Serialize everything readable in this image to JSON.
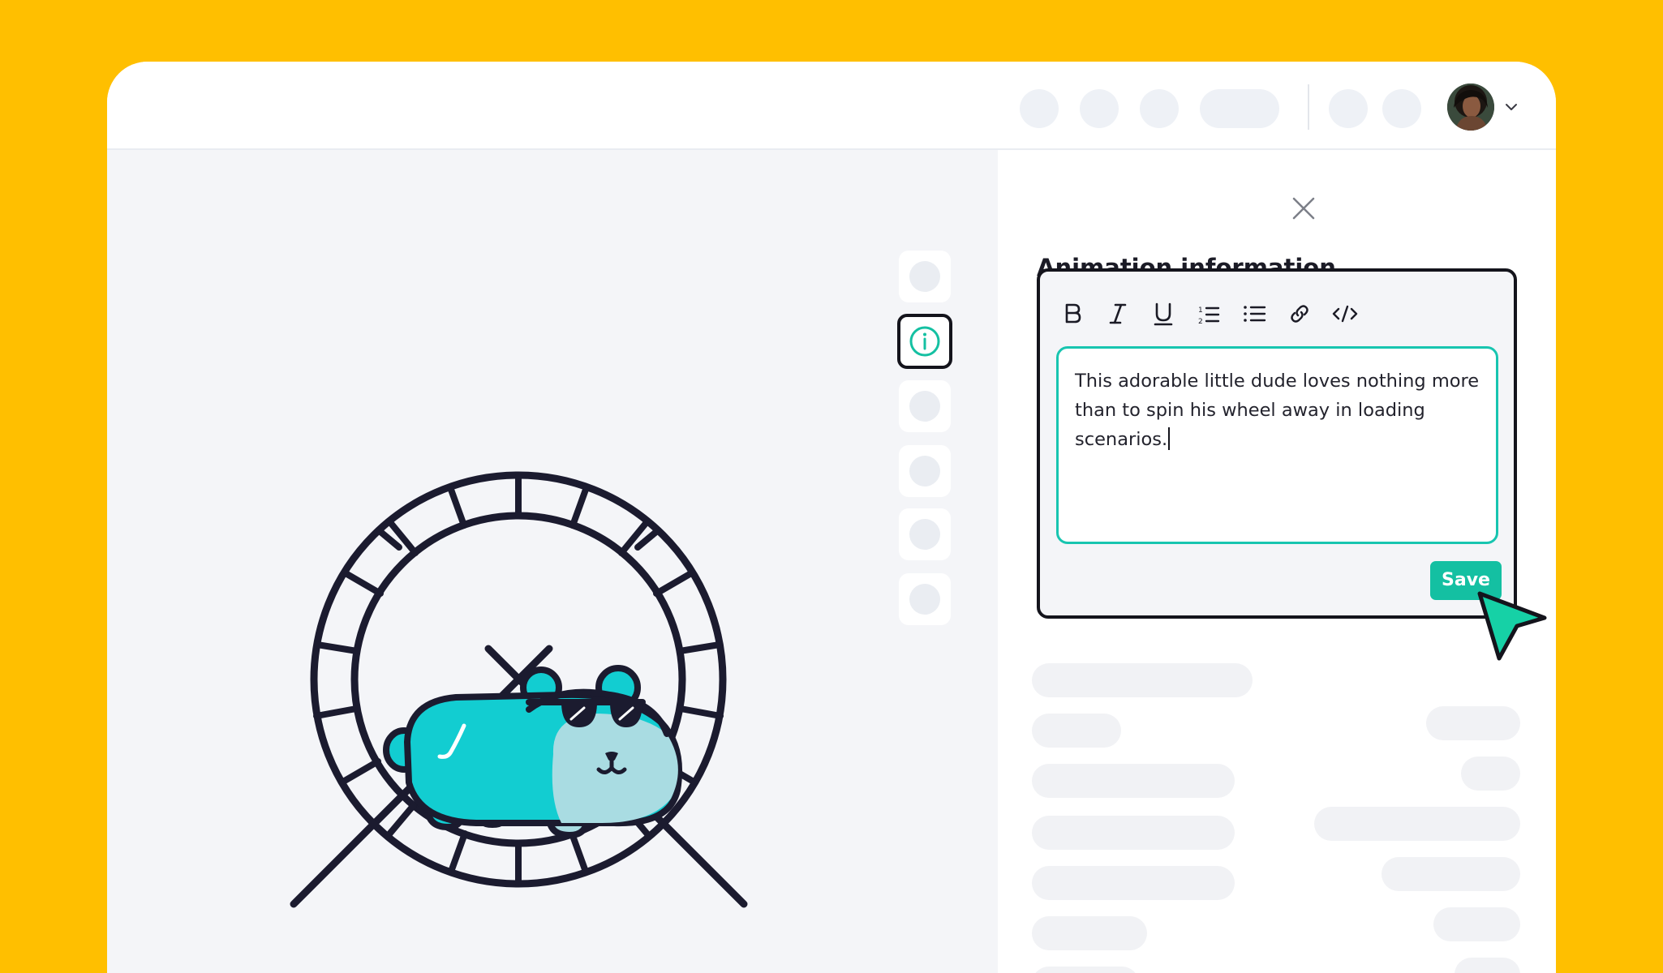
{
  "panel": {
    "title": "Animation information",
    "close_label": "Close"
  },
  "editor": {
    "toolbar": [
      "bold",
      "italic",
      "underline",
      "ordered-list",
      "bulleted-list",
      "link",
      "code"
    ],
    "text": "This adorable little dude loves nothing more than to spin his wheel away in loading scenarios.",
    "save_label": "Save"
  },
  "icons": {
    "info": "info-icon",
    "close": "close-icon",
    "avatar_menu": "chevron-down-icon",
    "cursor": "pointer-cursor-icon"
  },
  "colors": {
    "background": "#FFBF00",
    "accent": "#14C0A2",
    "hamster": "#12CDD1",
    "outline": "#14141C"
  }
}
